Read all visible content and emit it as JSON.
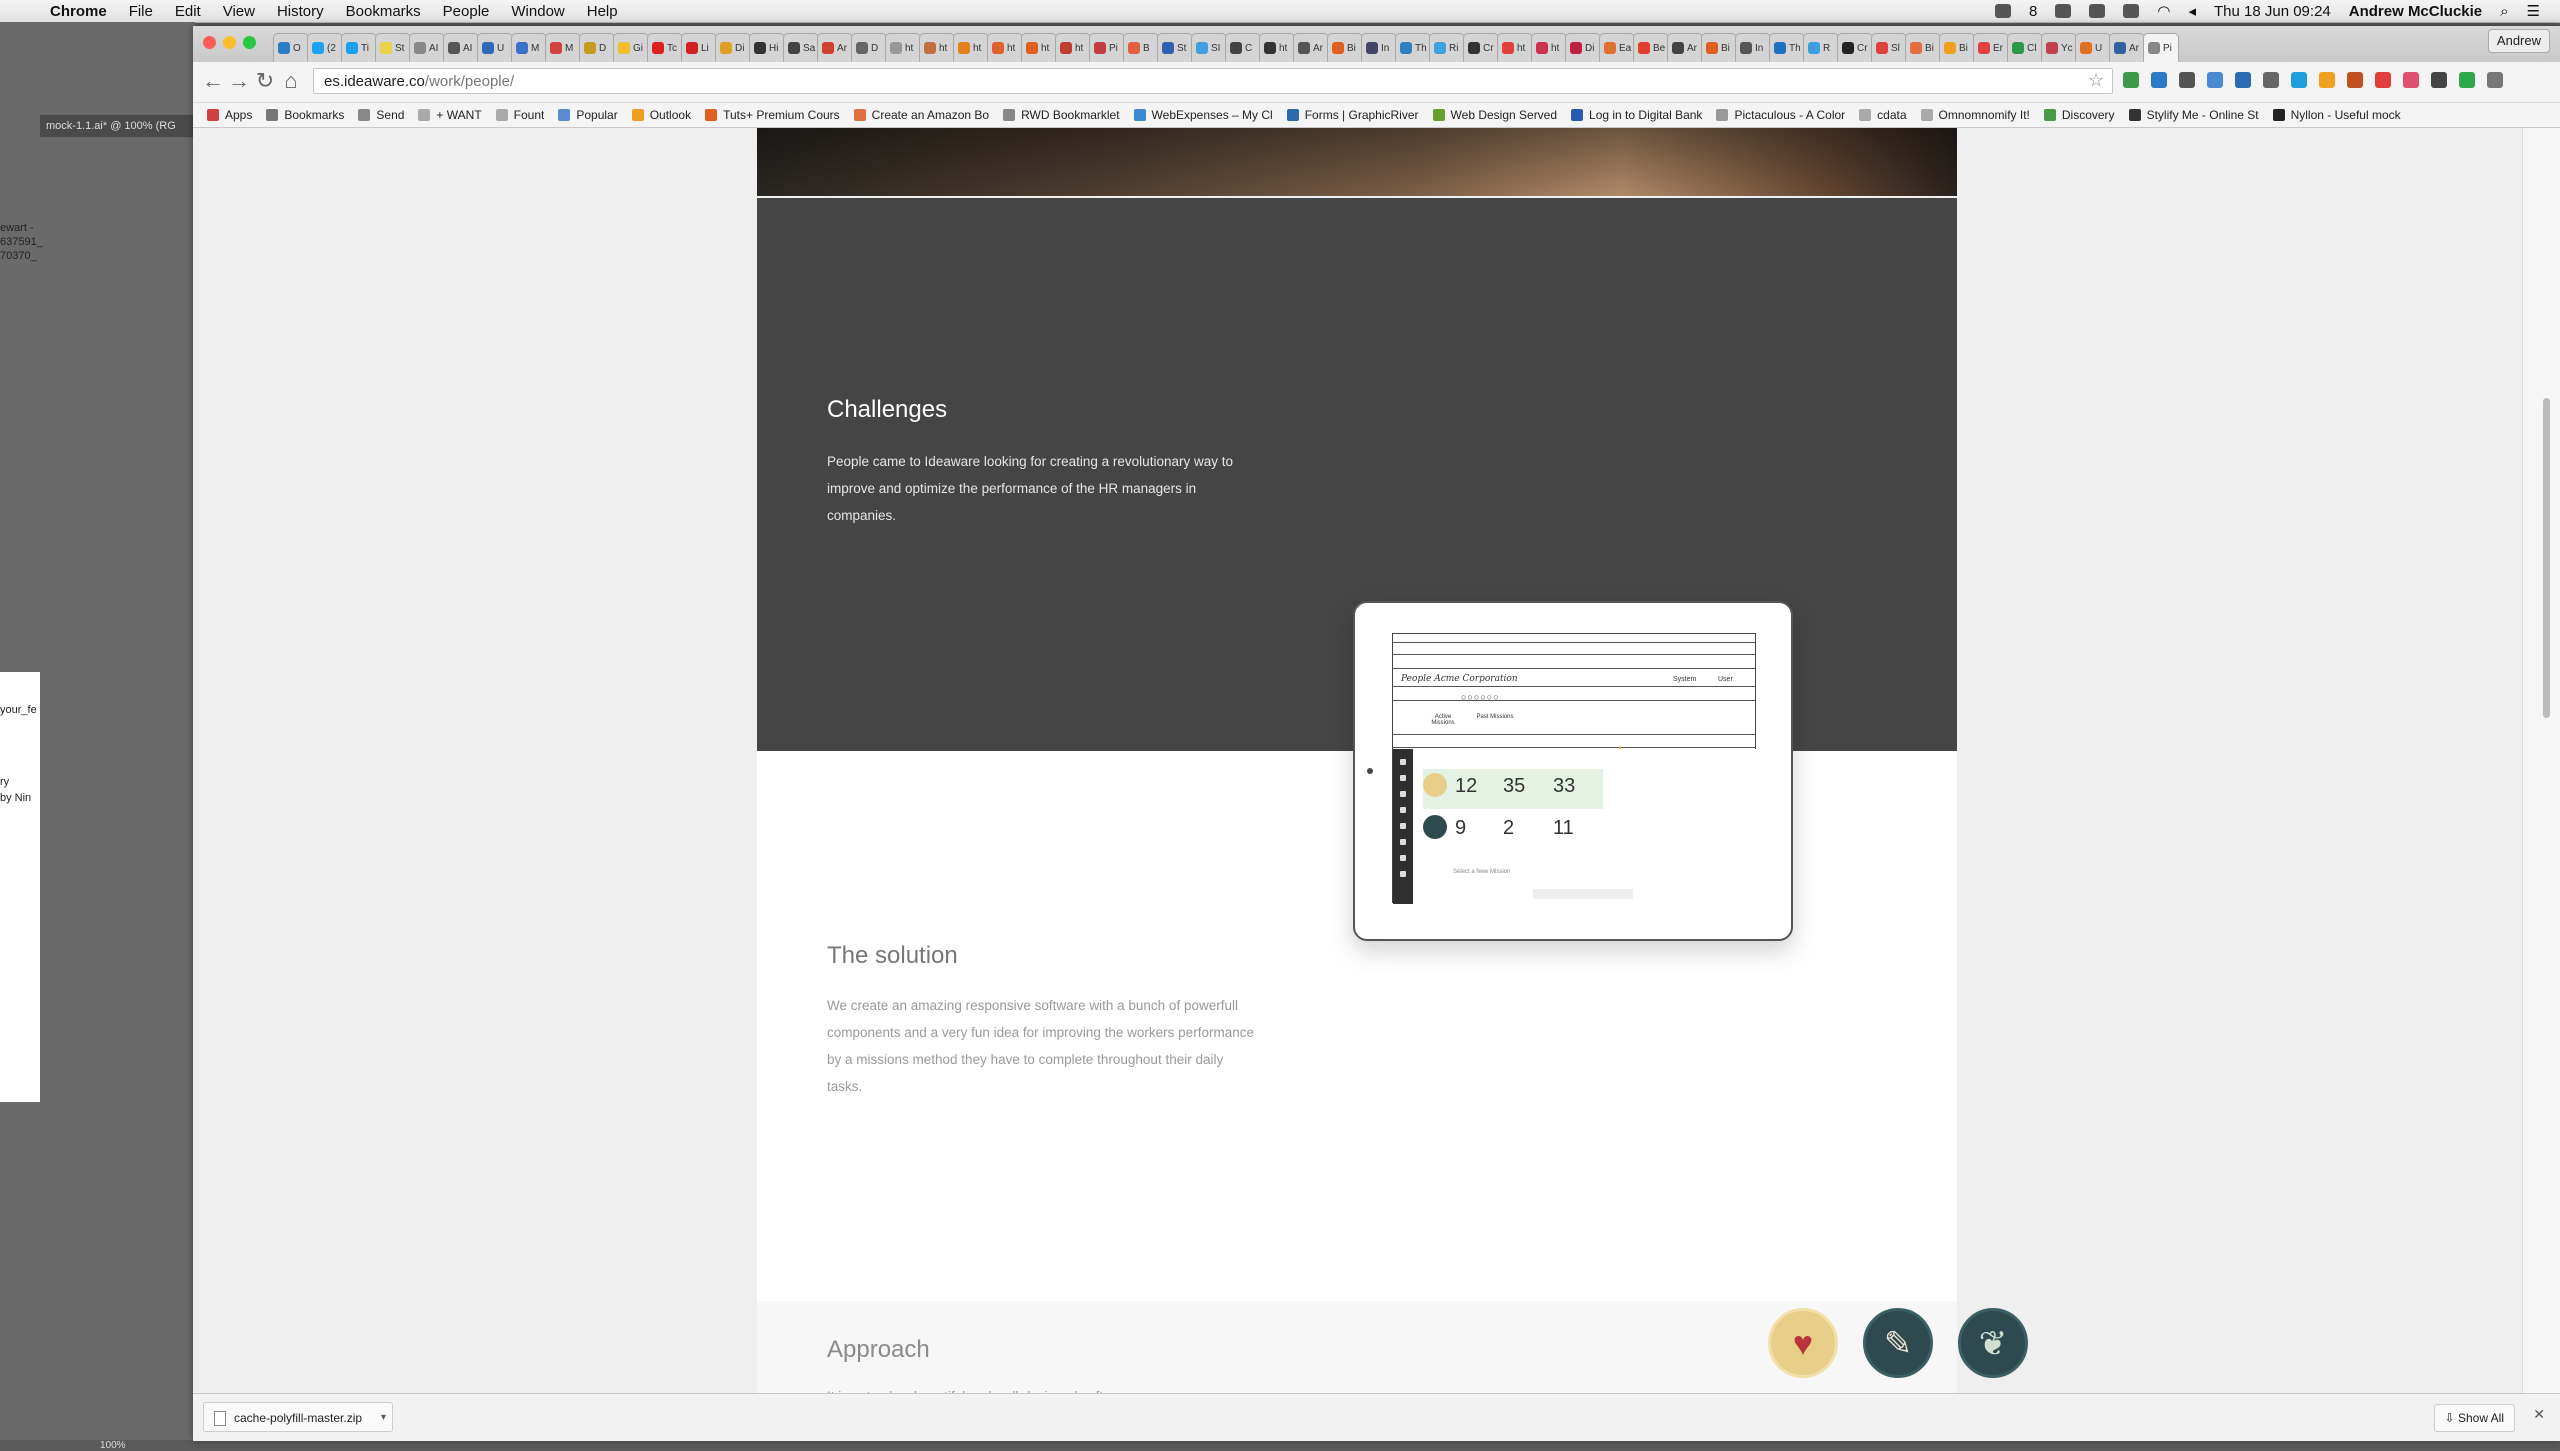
{
  "menubar": {
    "app": "Chrome",
    "menus": [
      "File",
      "Edit",
      "View",
      "History",
      "Bookmarks",
      "People",
      "Window",
      "Help"
    ],
    "battery": "8",
    "datetime": "Thu 18 Jun  09:24",
    "user": "Andrew McCluckie"
  },
  "bgapp": {
    "doc_tab": "mock-1.1.ai* @ 100% (RG",
    "side_texts": [
      "ewart -",
      "637591_",
      "70370_",
      "your_fe",
      "ry",
      "by Nin"
    ],
    "zoom": "100%"
  },
  "browser": {
    "profile": "Andrew",
    "tabs": [
      "O",
      "(2",
      "Ti",
      "St",
      "AI",
      "AI",
      "U",
      "M",
      "M",
      "D",
      "Gi",
      "Tc",
      "Li",
      "Di",
      "Hi",
      "Sa",
      "Ar",
      "D",
      "ht",
      "ht",
      "ht",
      "ht",
      "ht",
      "ht",
      "Pi",
      "B",
      "St",
      "SI",
      "C",
      "ht",
      "Ar",
      "Bi",
      "In",
      "Th",
      "Ri",
      "Cr",
      "ht",
      "ht",
      "Di",
      "Ea",
      "Be",
      "Ar",
      "Bi",
      "In",
      "Th",
      "R",
      "Cr",
      "Sl",
      "Bi",
      "Bi",
      "Er",
      "Cl",
      "Yc",
      "U",
      "Ar",
      "Pi"
    ],
    "active_tab_index": 55,
    "url_host": "es.ideaware.co",
    "url_path": "/work/people/",
    "bookmarks": [
      "Apps",
      "Bookmarks",
      "Send",
      "+ WANT",
      "Fount",
      "Popular",
      "Outlook",
      "Tuts+ Premium Cours",
      "Create an Amazon Bo",
      "RWD Bookmarklet",
      "WebExpenses – My Cl",
      "Forms | GraphicRiver",
      "Web Design Served",
      "Log in to Digital Bank",
      "Pictaculous - A Color",
      "cdata",
      "Omnomnomify It!",
      "Discovery",
      "Stylify Me - Online St",
      "Nyllon - Useful mock"
    ],
    "colors": {
      "tab_active": "#f4f4f4",
      "toolbar": "#f4f4f4"
    }
  },
  "page": {
    "challenges": {
      "title": "Challenges",
      "text": "People came to Ideaware looking for creating a revolutionary way to improve and optimize the performance of the HR managers in companies."
    },
    "solution": {
      "title": "The solution",
      "text": "We create an amazing responsive software with a bunch of powerfull components and a very fun idea for improving the workers performance by a missions method they have to complete throughout their daily tasks."
    },
    "approach": {
      "title": "Approach",
      "text": "It is not only a beautiful and well-designed software."
    },
    "mockup": {
      "company": "People Acme Corporation",
      "system": "System",
      "user": "User",
      "tab_active": "Active Missions",
      "tab_past": "Past Missions",
      "mission1": {
        "n1": "12",
        "n2": "35",
        "n3": "33"
      },
      "mission2": {
        "n1": "9",
        "n2": "2",
        "n3": "11"
      },
      "new_mission": "Select a New Mission"
    },
    "colors": {
      "dark_section": "#454545",
      "badge_gold": "#e7cf8a",
      "badge_teal": "#2e4a4e",
      "heart": "#b8333b"
    }
  },
  "shelf": {
    "download": "cache-polyfill-master.zip",
    "show_all": "Show All"
  }
}
